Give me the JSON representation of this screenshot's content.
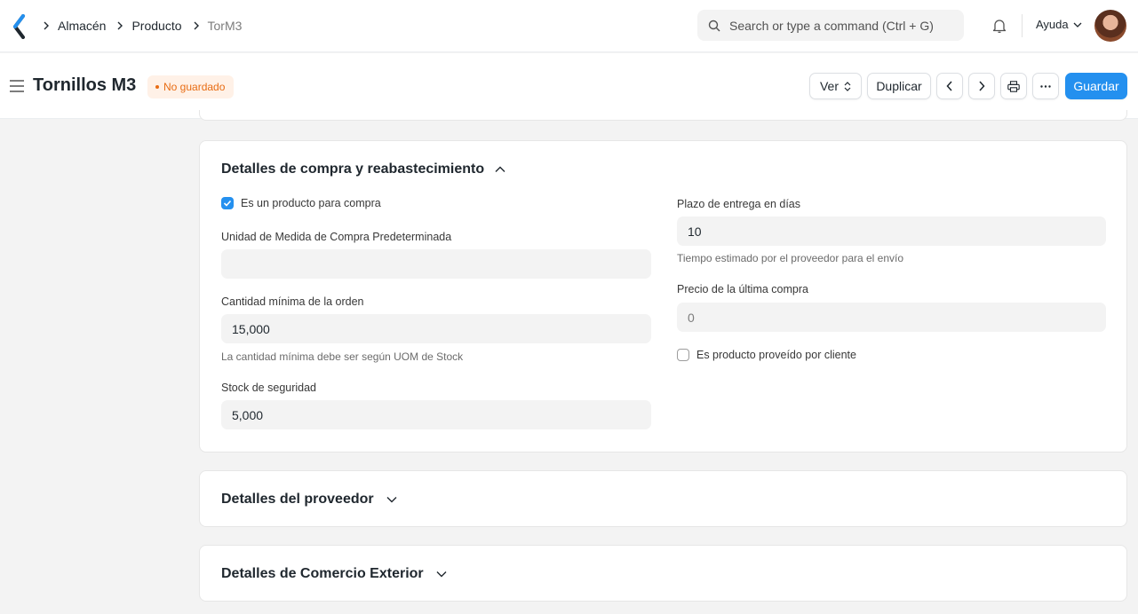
{
  "breadcrumbs": [
    "Almacén",
    "Producto",
    "TorM3"
  ],
  "search": {
    "placeholder": "Search or type a command (Ctrl + G)"
  },
  "navbar": {
    "help_label": "Ayuda"
  },
  "page": {
    "title": "Tornillos M3",
    "status_badge": "No guardado",
    "view_label": "Ver",
    "duplicate_label": "Duplicar",
    "save_label": "Guardar"
  },
  "purchase_section": {
    "title": "Detalles de compra y reabastecimiento",
    "is_purchase_item": {
      "label": "Es un producto para compra",
      "checked": true
    },
    "default_purchase_uom": {
      "label": "Unidad de Medida de Compra Predeterminada",
      "value": ""
    },
    "min_order_qty": {
      "label": "Cantidad mínima de la orden",
      "value": "15,000",
      "hint": "La cantidad mínima debe ser según UOM de Stock"
    },
    "safety_stock": {
      "label": "Stock de seguridad",
      "value": "5,000"
    },
    "lead_time_days": {
      "label": "Plazo de entrega en días",
      "value": "10",
      "hint": "Tiempo estimado por el proveedor para el envío"
    },
    "last_purchase_rate": {
      "label": "Precio de la última compra",
      "value": "0"
    },
    "is_customer_provided": {
      "label": "Es producto proveído por cliente",
      "checked": false
    }
  },
  "supplier_section": {
    "title": "Detalles del proveedor"
  },
  "foreign_trade_section": {
    "title": "Detalles de Comercio Exterior"
  },
  "colors": {
    "primary": "#2490ef",
    "warning": "#e86c13",
    "background": "#f3f3f3"
  }
}
